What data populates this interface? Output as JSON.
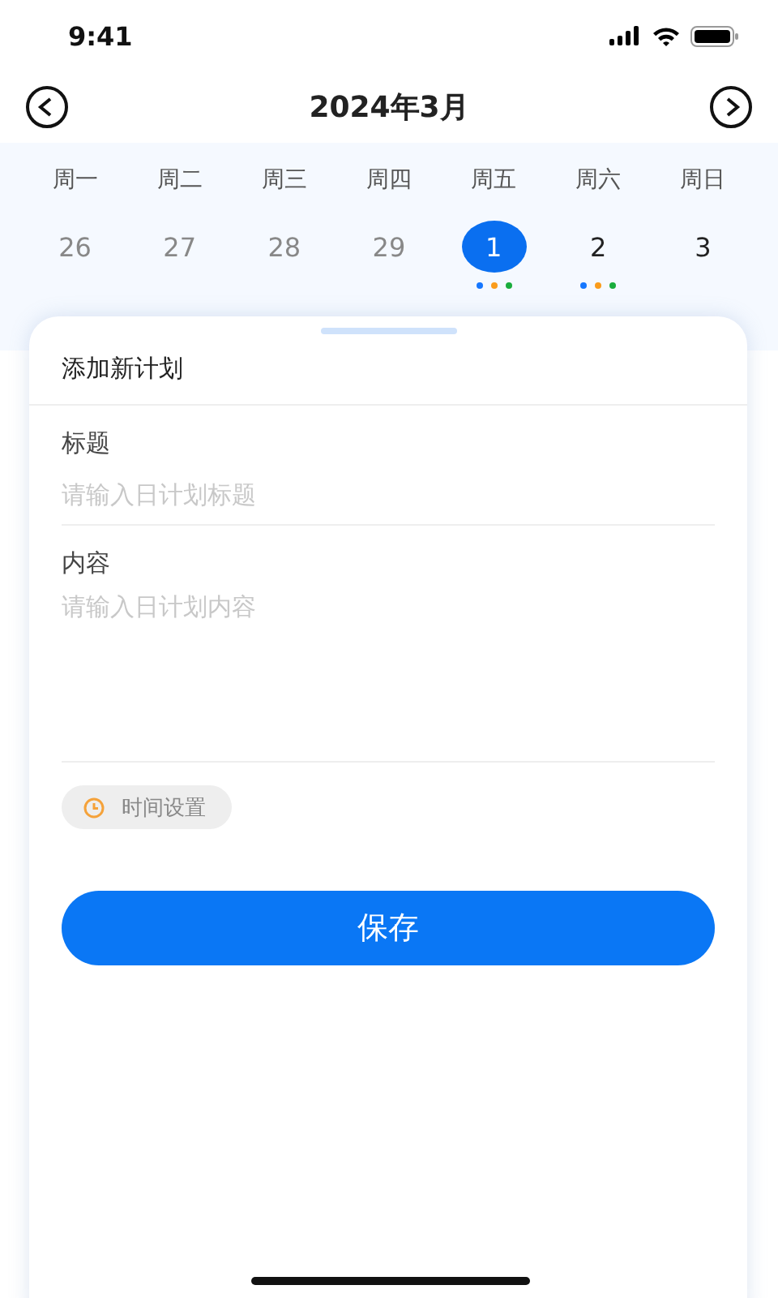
{
  "status_bar": {
    "time": "9:41"
  },
  "header": {
    "title": "2024年3月"
  },
  "weekdays": [
    "周一",
    "周二",
    "周三",
    "周四",
    "周五",
    "周六",
    "周日"
  ],
  "days": [
    {
      "label": "26",
      "other_month": true,
      "selected": false
    },
    {
      "label": "27",
      "other_month": true,
      "selected": false
    },
    {
      "label": "28",
      "other_month": true,
      "selected": false
    },
    {
      "label": "29",
      "other_month": true,
      "selected": false
    },
    {
      "label": "1",
      "other_month": false,
      "selected": true,
      "dots": [
        {
          "color": "#1677ff"
        },
        {
          "color": "#fa9c1b"
        },
        {
          "color": "#1aad3c"
        }
      ]
    },
    {
      "label": "2",
      "other_month": false,
      "selected": false,
      "dots": [
        {
          "color": "#1677ff"
        },
        {
          "color": "#fa9c1b"
        },
        {
          "color": "#1aad3c"
        }
      ]
    },
    {
      "label": "3",
      "other_month": false,
      "selected": false
    }
  ],
  "sheet": {
    "title": "添加新计划",
    "fields": [
      {
        "label": "标题",
        "placeholder": "请输入日计划标题",
        "kind": "line"
      },
      {
        "label": "内容",
        "placeholder": "请输入日计划内容",
        "kind": "area"
      }
    ],
    "time_chip": "时间设置",
    "save_button": "保存"
  }
}
